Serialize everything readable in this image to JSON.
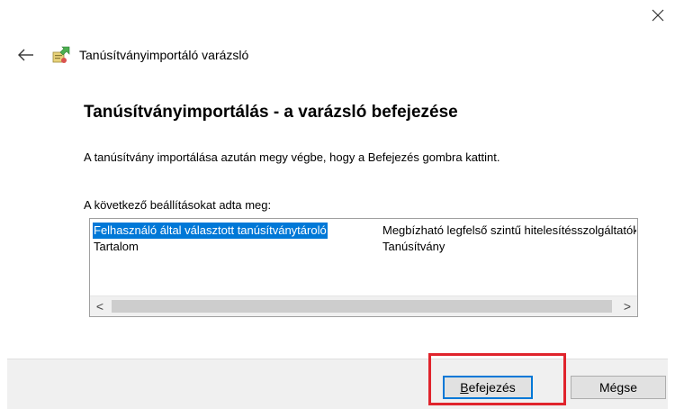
{
  "window": {
    "close_icon": "close-icon",
    "back_icon": "back-arrow-icon",
    "wizard_icon": "certificate-wizard-icon",
    "wizard_title": "Tanúsítványimportáló varázsló"
  },
  "main": {
    "heading": "Tanúsítványimportálás - a varázsló befejezése",
    "description": "A tanúsítvány importálása azután megy végbe, hogy a Befejezés gombra kattint.",
    "list_label": "A következő beállításokat adta meg:",
    "settings_rows": [
      {
        "setting": "Felhasználó által választott tanúsítványtároló",
        "value": "Megbízható legfelső szintű hitelesítésszolgáltatók",
        "selected": true
      },
      {
        "setting": "Tartalom",
        "value": "Tanúsítvány",
        "selected": false
      }
    ],
    "scroll_left_glyph": "<",
    "scroll_right_glyph": ">"
  },
  "footer": {
    "finish_label_underlined": "B",
    "finish_label_rest": "efejezés",
    "cancel_label": "Mégse"
  },
  "colors": {
    "selection": "#0078d7",
    "highlight_frame": "#e0242c",
    "footer_bg": "#f0f0f0"
  }
}
